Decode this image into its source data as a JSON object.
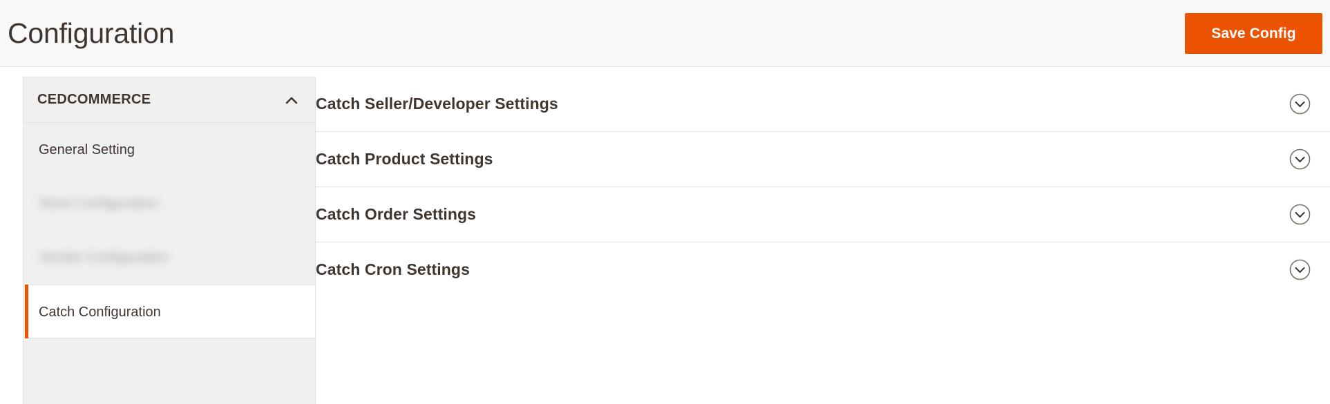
{
  "header": {
    "title": "Configuration",
    "save_button_label": "Save Config",
    "accent_color": "#eb5202",
    "background_color": "#f8f8f8"
  },
  "sidebar": {
    "section_label": "CEDCOMMERCE",
    "collapse_icon": "chevron-up-icon",
    "items": [
      {
        "label": "General Setting",
        "state": "normal"
      },
      {
        "label": "Store Configuration",
        "state": "blurred"
      },
      {
        "label": "Vendor Configuration",
        "state": "blurred"
      },
      {
        "label": "Catch Configuration",
        "state": "active"
      }
    ]
  },
  "main": {
    "sections": [
      {
        "title": "Catch Seller/Developer Settings",
        "expand_icon": "chevron-down-circle-icon",
        "expanded": false
      },
      {
        "title": "Catch Product Settings",
        "expand_icon": "chevron-down-circle-icon",
        "expanded": false
      },
      {
        "title": "Catch Order Settings",
        "expand_icon": "chevron-down-circle-icon",
        "expanded": false
      },
      {
        "title": "Catch Cron Settings",
        "expand_icon": "chevron-down-circle-icon",
        "expanded": false
      }
    ]
  }
}
